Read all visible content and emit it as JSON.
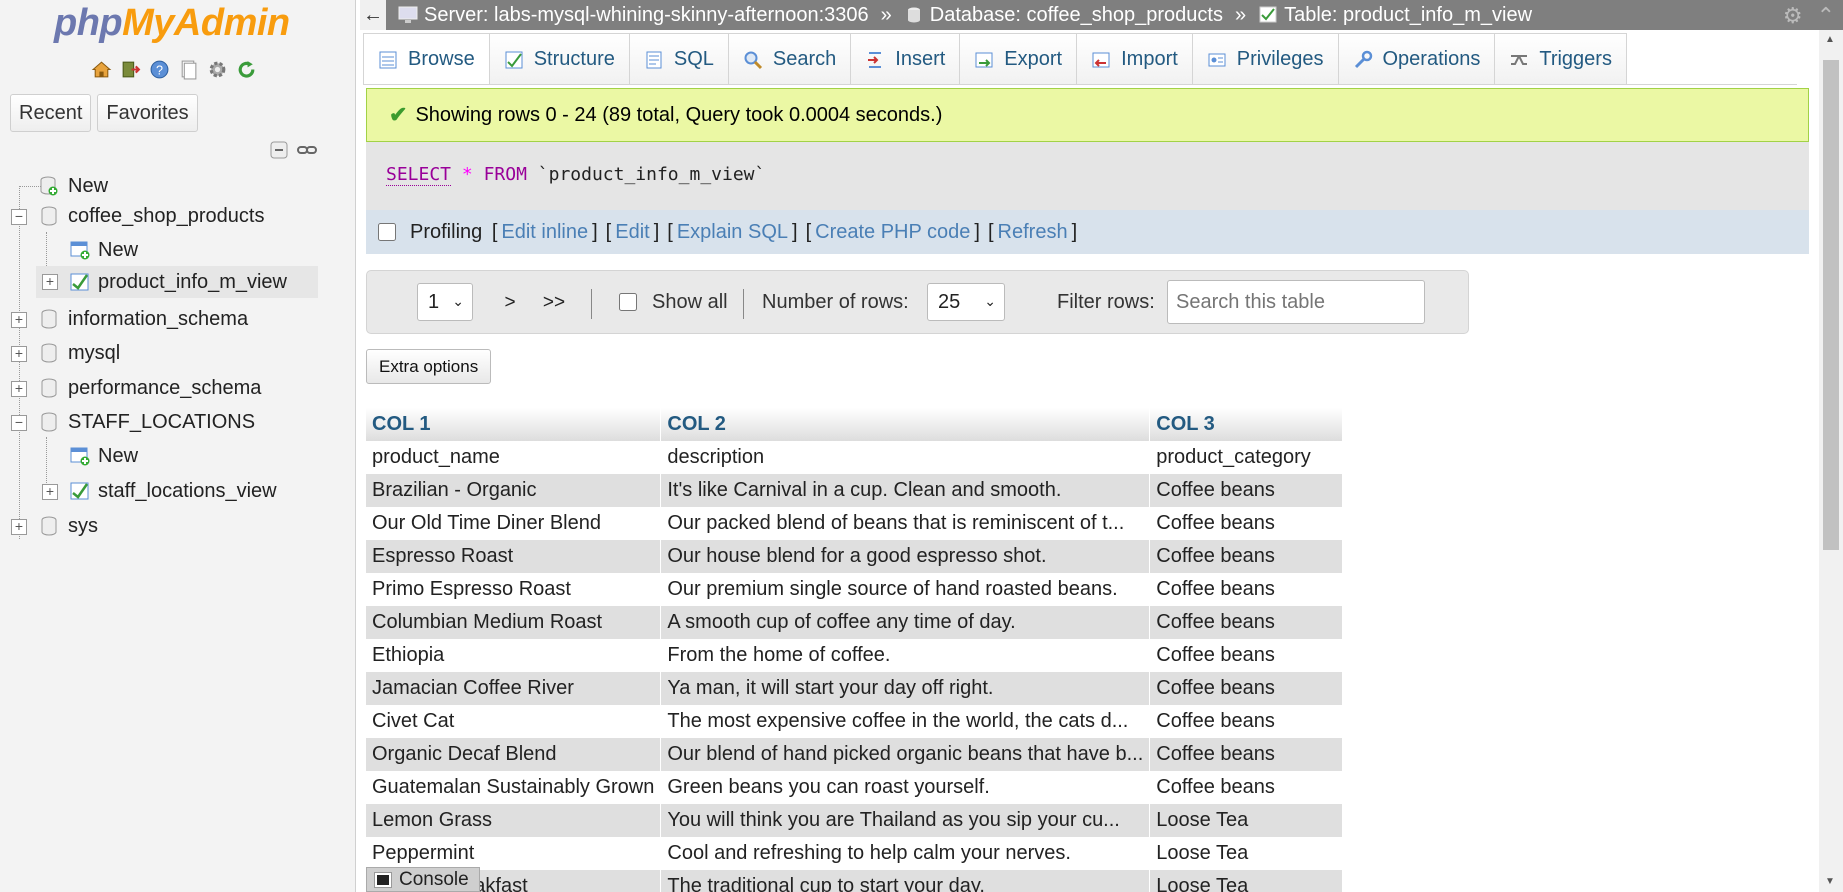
{
  "sidebar": {
    "logo_php": "php",
    "logo_myadmin": "MyAdmin",
    "recent_label": "Recent",
    "favorites_label": "Favorites",
    "tree": [
      {
        "label": "New"
      },
      {
        "label": "coffee_shop_products"
      },
      {
        "label": "New"
      },
      {
        "label": "product_info_m_view"
      },
      {
        "label": "information_schema"
      },
      {
        "label": "mysql"
      },
      {
        "label": "performance_schema"
      },
      {
        "label": "STAFF_LOCATIONS"
      },
      {
        "label": "New"
      },
      {
        "label": "staff_locations_view"
      },
      {
        "label": "sys"
      }
    ]
  },
  "breadcrumb": {
    "server": "Server: labs-mysql-whining-skinny-afternoon:3306",
    "database": "Database: coffee_shop_products",
    "table": "Table: product_info_m_view",
    "sep": "»"
  },
  "tabs": [
    "Browse",
    "Structure",
    "SQL",
    "Search",
    "Insert",
    "Export",
    "Import",
    "Privileges",
    "Operations",
    "Triggers"
  ],
  "success_message": "Showing rows 0 - 24 (89 total, Query took 0.0004 seconds.)",
  "sql": {
    "select": "SELECT",
    "star": "*",
    "from": "FROM",
    "table": "`product_info_m_view`"
  },
  "profiling": {
    "label": "Profiling",
    "edit_inline": "Edit inline",
    "edit": "Edit",
    "explain": "Explain SQL",
    "create_php": "Create PHP code",
    "refresh": "Refresh"
  },
  "navigation": {
    "page_value": "1",
    "next": ">",
    "last": ">>",
    "show_all": "Show all",
    "rows_label": "Number of rows:",
    "rows_value": "25",
    "filter_label": "Filter rows:",
    "search_placeholder": "Search this table"
  },
  "extra_options": "Extra options",
  "table": {
    "headers": [
      "COL 1",
      "COL 2",
      "COL 3"
    ],
    "rows": [
      [
        "product_name",
        "description",
        "product_category"
      ],
      [
        "Brazilian - Organic",
        "It's like Carnival in a cup. Clean and smooth.",
        "Coffee beans"
      ],
      [
        "Our Old Time Diner Blend",
        "Our packed blend of beans that is reminiscent of t...",
        "Coffee beans"
      ],
      [
        "Espresso Roast",
        "Our house blend for a good espresso shot.",
        "Coffee beans"
      ],
      [
        "Primo Espresso Roast",
        "Our premium single source of hand roasted beans.",
        "Coffee beans"
      ],
      [
        "Columbian Medium Roast",
        "A smooth cup of coffee any time of day.",
        "Coffee beans"
      ],
      [
        "Ethiopia",
        "From the home of coffee.",
        "Coffee beans"
      ],
      [
        "Jamacian Coffee River",
        "Ya man, it will start your day off right.",
        "Coffee beans"
      ],
      [
        "Civet Cat",
        "The most expensive coffee in the world, the cats d...",
        "Coffee beans"
      ],
      [
        "Organic Decaf Blend",
        "Our blend of hand picked organic beans that have b...",
        "Coffee beans"
      ],
      [
        "Guatemalan Sustainably Grown",
        "Green beans you can roast yourself.",
        "Coffee beans"
      ],
      [
        "Lemon Grass",
        "You will think you are Thailand as you sip your cu...",
        "Loose Tea"
      ],
      [
        "Peppermint",
        "Cool and refreshing to help calm your nerves.",
        "Loose Tea"
      ],
      [
        "English Breakfast",
        "The traditional cup to start your day.",
        "Loose Tea"
      ]
    ]
  },
  "console_label": "Console"
}
